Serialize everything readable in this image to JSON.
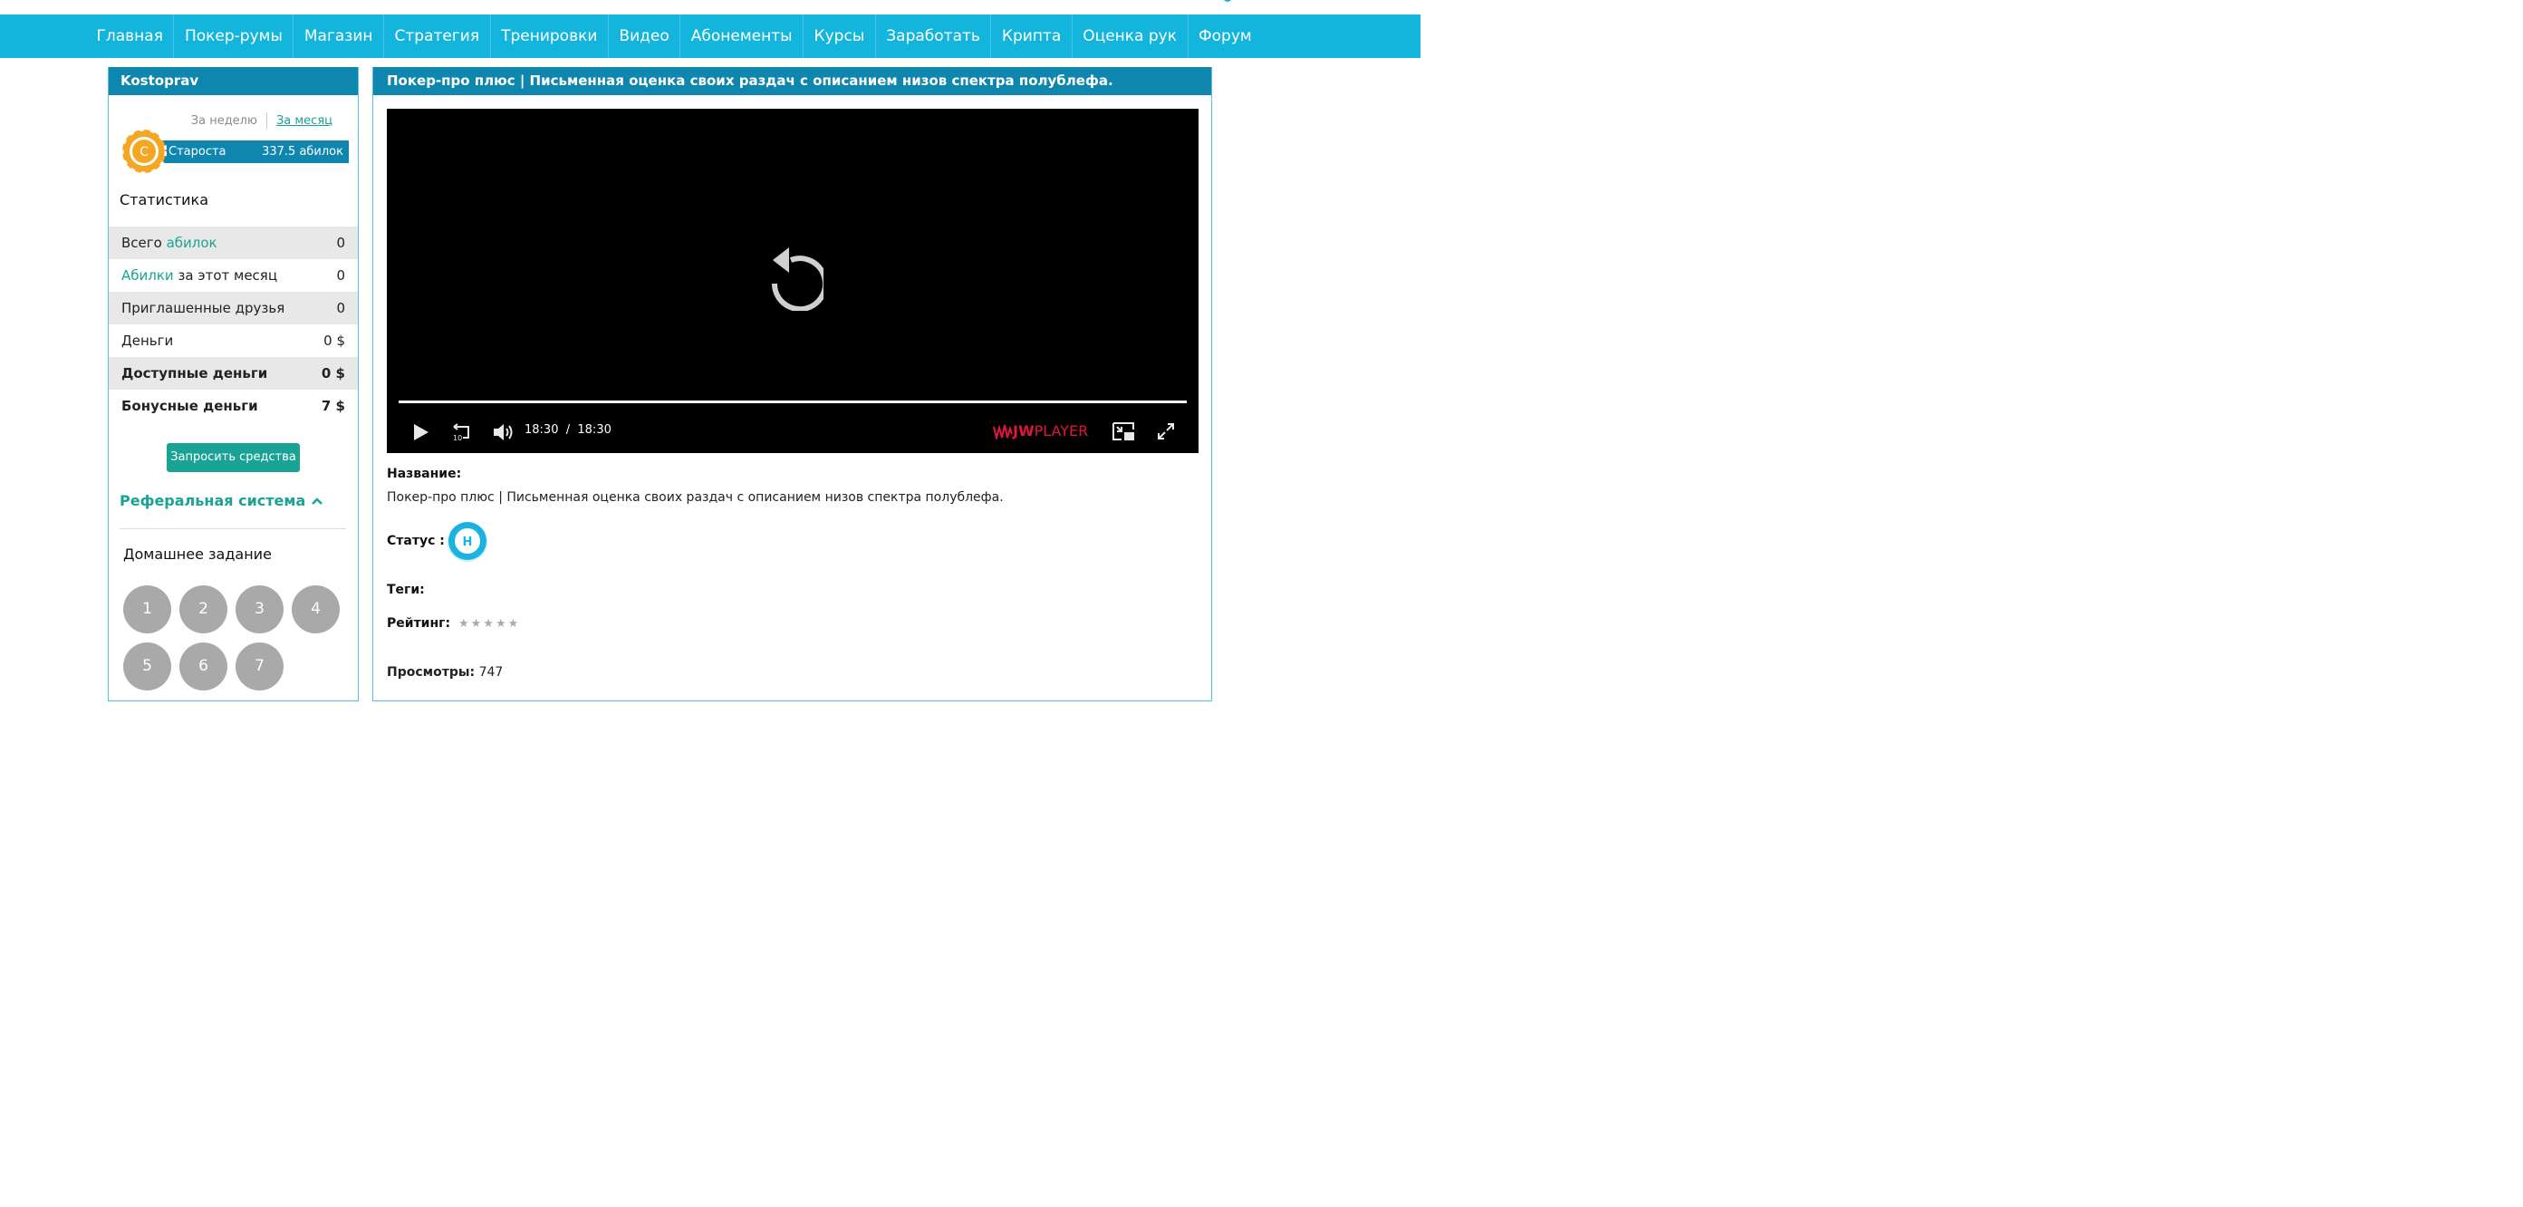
{
  "nav": [
    "Главная",
    "Покер-румы",
    "Магазин",
    "Стратегия",
    "Тренировки",
    "Видео",
    "Абонементы",
    "Курсы",
    "Заработать",
    "Крипта",
    "Оценка рук",
    "Форум"
  ],
  "sidebar": {
    "username": "Kostoprav",
    "period_week": "За неделю",
    "period_month": "За месяц",
    "chip_letter": "C",
    "rank_name": "Староста",
    "rank_value": "337.5 абилок",
    "stats_title": "Статистика",
    "stats": [
      {
        "pre": "Всего ",
        "accent": "абилок",
        "post": "",
        "value": "0"
      },
      {
        "pre": "",
        "accent": "Абилки",
        "post": " за этот месяц",
        "value": "0"
      },
      {
        "pre": "Приглашенные друзья",
        "accent": "",
        "post": "",
        "value": "0"
      },
      {
        "pre": "Деньги",
        "accent": "",
        "post": "",
        "value": "0 $"
      },
      {
        "pre": "Доступные деньги",
        "accent": "",
        "post": "",
        "value": "0 $"
      },
      {
        "pre": "Бонусные деньги",
        "accent": "",
        "post": "",
        "value": "7 $"
      }
    ],
    "request_button": "Запросить средства",
    "referral": "Реферальная система",
    "homework_title": "Домашнее задание",
    "homework": [
      "1",
      "2",
      "3",
      "4",
      "5",
      "6",
      "7"
    ]
  },
  "main": {
    "title": "Покер-про плюс | Письменная оценка своих раздач с описанием низов спектра полублефа.",
    "player": {
      "time_current": "18:30",
      "time_sep": "/",
      "time_total": "18:30",
      "brand_bold": "JW",
      "brand_thin": "PLAYER",
      "rewind_label": "10",
      "progress": 1.0
    },
    "name_label": "Название:",
    "name_value": "Покер-про плюс | Письменная оценка своих раздач с описанием низов спектра полублефа.",
    "status_label": "Статус :",
    "status_letter": "Н",
    "tags_label": "Теги:",
    "rating_label": "Рейтинг:",
    "rating_stars": "★★★★★",
    "rating_value": 0,
    "views_label": "Просмотры:",
    "views_value": "747"
  },
  "colors": {
    "nav_bg": "#14b5dd",
    "header_bg": "#0f86ad",
    "accent": "#1aa394",
    "jw_red": "#e0163a"
  }
}
